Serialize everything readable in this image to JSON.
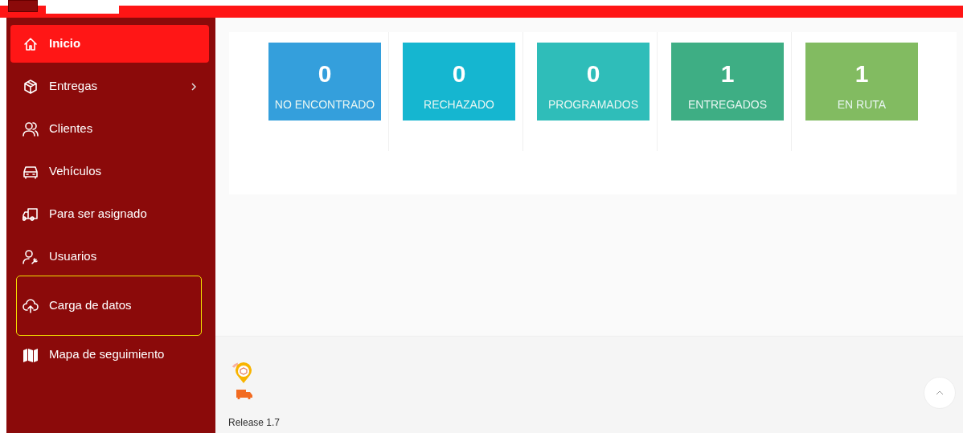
{
  "sidebar": {
    "items": [
      {
        "label": "Inicio",
        "selected": true,
        "highlighted": false,
        "has_submenu": false
      },
      {
        "label": "Entregas",
        "selected": false,
        "highlighted": false,
        "has_submenu": true
      },
      {
        "label": "Clientes",
        "selected": false,
        "highlighted": false,
        "has_submenu": false
      },
      {
        "label": "Vehículos",
        "selected": false,
        "highlighted": false,
        "has_submenu": false
      },
      {
        "label": "Para ser asignado",
        "selected": false,
        "highlighted": false,
        "has_submenu": false
      },
      {
        "label": "Usuarios",
        "selected": false,
        "highlighted": false,
        "has_submenu": false
      },
      {
        "label": "Carga de datos",
        "selected": false,
        "highlighted": true,
        "has_submenu": false
      },
      {
        "label": "Mapa de seguimiento",
        "selected": false,
        "highlighted": false,
        "has_submenu": false
      }
    ]
  },
  "stats": [
    {
      "value": "0",
      "label": "NO ENCONTRADO",
      "color": "#349fdc"
    },
    {
      "value": "0",
      "label": "RECHAZADO",
      "color": "#15b6d0"
    },
    {
      "value": "0",
      "label": "PROGRAMADOS",
      "color": "#2fbdb9"
    },
    {
      "value": "1",
      "label": "ENTREGADOS",
      "color": "#3eae84"
    },
    {
      "value": "1",
      "label": "EN RUTA",
      "color": "#82bb61"
    }
  ],
  "footer": {
    "release": "Release 1.7"
  }
}
